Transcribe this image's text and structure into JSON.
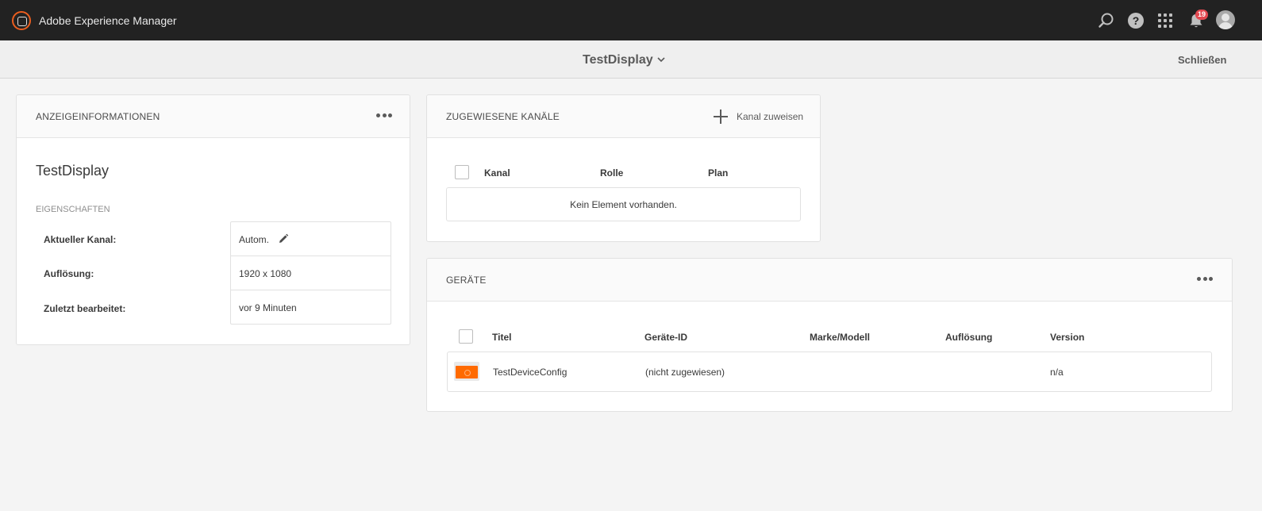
{
  "topbar": {
    "app_title": "Adobe Experience Manager",
    "notification_count": "19",
    "icons": [
      "aem-logo-icon",
      "search-icon",
      "help-icon",
      "apps-grid-icon",
      "bell-icon",
      "avatar"
    ]
  },
  "actionbar": {
    "title": "TestDisplay",
    "close_label": "Schließen"
  },
  "info_card": {
    "title": "ANZEIGEINFORMATIONEN",
    "display_name": "TestDisplay",
    "section_label": "EIGENSCHAFTEN",
    "properties": [
      {
        "label": "Aktueller Kanal:",
        "value": "Autom."
      },
      {
        "label": "Auflösung:",
        "value": "1920 x 1080"
      },
      {
        "label": "Zuletzt bearbeitet:",
        "value": "vor 9 Minuten"
      }
    ]
  },
  "channels_card": {
    "title": "ZUGEWIESENE KANÄLE",
    "assign_label": "Kanal zuweisen",
    "columns": [
      "Kanal",
      "Rolle",
      "Plan"
    ],
    "empty_text": "Kein Element vorhanden."
  },
  "devices_card": {
    "title": "GERÄTE",
    "columns": [
      "Titel",
      "Geräte-ID",
      "Marke/Modell",
      "Auflösung",
      "Version"
    ],
    "rows": [
      {
        "title": "TestDeviceConfig",
        "device_id": "(nicht zugewiesen)",
        "model": "",
        "resolution": "",
        "version": "n/a"
      }
    ]
  },
  "colors": {
    "topbar_bg": "#222222",
    "accent_orange": "#ff6a00",
    "badge_red": "#e34850",
    "page_bg": "#f4f4f4"
  }
}
